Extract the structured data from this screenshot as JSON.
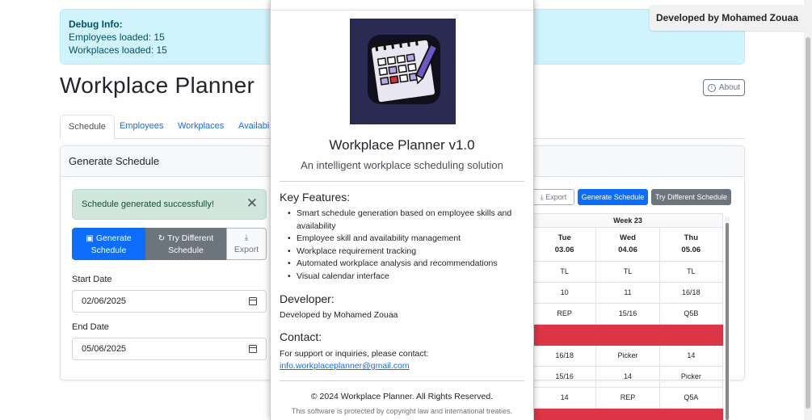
{
  "debug": {
    "title": "Debug Info:",
    "employees": "Employees loaded: 15",
    "workplaces": "Workplaces loaded: 15"
  },
  "developer_tag": "Developed by Mohamed Zouaa",
  "app": {
    "title": "Workplace Planner",
    "about_label": "About"
  },
  "tabs": [
    {
      "label": "Schedule",
      "active": true
    },
    {
      "label": "Employees"
    },
    {
      "label": "Workplaces"
    },
    {
      "label": "Availabi"
    }
  ],
  "generate": {
    "card_title": "Generate Schedule",
    "success_message": "Schedule generated successfully!",
    "buttons": {
      "generate": [
        "Generate",
        "Schedule"
      ],
      "try_again": [
        "Try Different",
        "Schedule"
      ],
      "export": "Export"
    },
    "start_label": "Start Date",
    "start_value": "02/06/2025",
    "end_label": "End Date",
    "end_value": "05/06/2025"
  },
  "toolbar": {
    "export": "Export",
    "generate": "Generate Schedule",
    "try_different": "Try Different Schedule"
  },
  "schedule": {
    "week": "Week 23",
    "days": [
      {
        "name": "Tue",
        "date": "03.06"
      },
      {
        "name": "Wed",
        "date": "04.06"
      },
      {
        "name": "Thu",
        "date": "05.06"
      }
    ],
    "rows": [
      {
        "cells": [
          "TL",
          "TL",
          "TL"
        ]
      },
      {
        "cells": [
          "10",
          "11",
          "16/18"
        ]
      },
      {
        "cells": [
          "REP",
          "15/16",
          "Q5B"
        ]
      },
      {
        "cells": [
          "",
          "",
          ""
        ],
        "status": "red"
      },
      {
        "cells": [
          "16/18",
          "Picker",
          "14"
        ]
      },
      {
        "cells": [
          "15/16",
          "14",
          "Picker"
        ]
      },
      {
        "cells": [
          "14",
          "REP",
          "Q5A"
        ]
      },
      {
        "cells": [
          "",
          "",
          ""
        ],
        "status": "red"
      }
    ],
    "colors": {
      "highlight": "#dc3545"
    }
  },
  "modal": {
    "title": "Workplace Planner v1.0",
    "subtitle": "An intelligent workplace scheduling solution",
    "features_heading": "Key Features:",
    "features": [
      "Smart schedule generation based on employee skills and availability",
      "Employee skill and availability management",
      "Workplace requirement tracking",
      "Automated workplace analysis and recommendations",
      "Visual calendar interface"
    ],
    "developer_heading": "Developer:",
    "developer_text": "Developed by Mohamed Zouaa",
    "contact_heading": "Contact:",
    "contact_text": "For support or inquiries, please contact:",
    "contact_email": "info.workplaceplanner@gmail.com",
    "copyright": "© 2024 Workplace Planner. All Rights Reserved.",
    "legal": "This software is protected by copyright law and international treaties."
  },
  "icons": {
    "logo": "calendar-notebook-logo",
    "about": "info-icon",
    "close": "close-icon",
    "calendar": "calendar-icon",
    "refresh": "refresh-icon",
    "download": "download-icon"
  },
  "colors": {
    "primary": "#0d6efd",
    "secondary": "#6c757d",
    "success_bg": "#d1e7dd",
    "info_bg": "#cff4fc",
    "danger": "#dc3545"
  }
}
